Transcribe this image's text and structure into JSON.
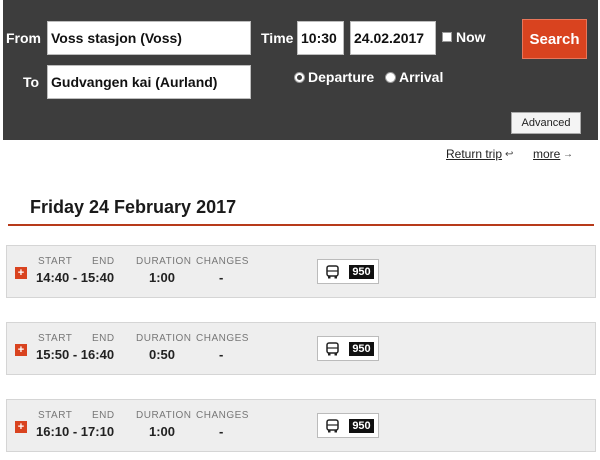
{
  "search": {
    "from_label": "From",
    "from_value": "Voss stasjon (Voss)",
    "to_label": "To",
    "to_value": "Gudvangen kai (Aurland)",
    "time_label": "Time",
    "time_value": "10:30",
    "date_value": "24.02.2017",
    "now_label": "Now",
    "departure_label": "Departure",
    "arrival_label": "Arrival",
    "search_label": "Search",
    "advanced_label": "Advanced"
  },
  "links": {
    "return_trip": "Return trip",
    "more": "more"
  },
  "date_heading": "Friday 24 February 2017",
  "columns": {
    "start": "START",
    "end": "END",
    "duration": "DURATION",
    "changes": "CHANGES"
  },
  "trips": [
    {
      "time_range": "14:40 - 15:40",
      "duration": "1:00",
      "changes": "-",
      "route": "950",
      "mode": "bus-icon"
    },
    {
      "time_range": "15:50 - 16:40",
      "duration": "0:50",
      "changes": "-",
      "route": "950",
      "mode": "bus-icon"
    },
    {
      "time_range": "16:10 - 17:10",
      "duration": "1:00",
      "changes": "-",
      "route": "950",
      "mode": "bus-icon"
    }
  ],
  "colors": {
    "panel": "#3d3d3d",
    "accent": "#d9431f",
    "divider": "#b73a1a"
  }
}
